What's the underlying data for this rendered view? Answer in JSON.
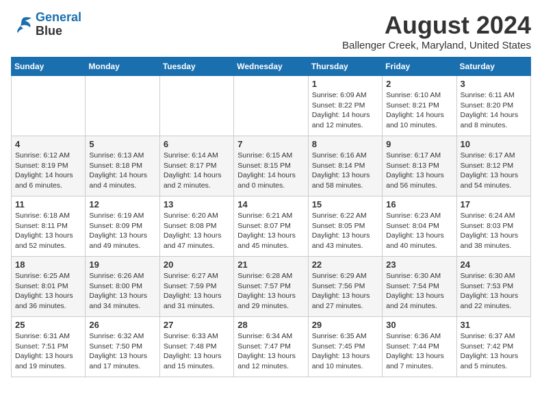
{
  "logo": {
    "line1": "General",
    "line2": "Blue"
  },
  "title": "August 2024",
  "location": "Ballenger Creek, Maryland, United States",
  "days_of_week": [
    "Sunday",
    "Monday",
    "Tuesday",
    "Wednesday",
    "Thursday",
    "Friday",
    "Saturday"
  ],
  "weeks": [
    [
      {
        "day": "",
        "info": ""
      },
      {
        "day": "",
        "info": ""
      },
      {
        "day": "",
        "info": ""
      },
      {
        "day": "",
        "info": ""
      },
      {
        "day": "1",
        "info": "Sunrise: 6:09 AM\nSunset: 8:22 PM\nDaylight: 14 hours\nand 12 minutes."
      },
      {
        "day": "2",
        "info": "Sunrise: 6:10 AM\nSunset: 8:21 PM\nDaylight: 14 hours\nand 10 minutes."
      },
      {
        "day": "3",
        "info": "Sunrise: 6:11 AM\nSunset: 8:20 PM\nDaylight: 14 hours\nand 8 minutes."
      }
    ],
    [
      {
        "day": "4",
        "info": "Sunrise: 6:12 AM\nSunset: 8:19 PM\nDaylight: 14 hours\nand 6 minutes."
      },
      {
        "day": "5",
        "info": "Sunrise: 6:13 AM\nSunset: 8:18 PM\nDaylight: 14 hours\nand 4 minutes."
      },
      {
        "day": "6",
        "info": "Sunrise: 6:14 AM\nSunset: 8:17 PM\nDaylight: 14 hours\nand 2 minutes."
      },
      {
        "day": "7",
        "info": "Sunrise: 6:15 AM\nSunset: 8:15 PM\nDaylight: 14 hours\nand 0 minutes."
      },
      {
        "day": "8",
        "info": "Sunrise: 6:16 AM\nSunset: 8:14 PM\nDaylight: 13 hours\nand 58 minutes."
      },
      {
        "day": "9",
        "info": "Sunrise: 6:17 AM\nSunset: 8:13 PM\nDaylight: 13 hours\nand 56 minutes."
      },
      {
        "day": "10",
        "info": "Sunrise: 6:17 AM\nSunset: 8:12 PM\nDaylight: 13 hours\nand 54 minutes."
      }
    ],
    [
      {
        "day": "11",
        "info": "Sunrise: 6:18 AM\nSunset: 8:11 PM\nDaylight: 13 hours\nand 52 minutes."
      },
      {
        "day": "12",
        "info": "Sunrise: 6:19 AM\nSunset: 8:09 PM\nDaylight: 13 hours\nand 49 minutes."
      },
      {
        "day": "13",
        "info": "Sunrise: 6:20 AM\nSunset: 8:08 PM\nDaylight: 13 hours\nand 47 minutes."
      },
      {
        "day": "14",
        "info": "Sunrise: 6:21 AM\nSunset: 8:07 PM\nDaylight: 13 hours\nand 45 minutes."
      },
      {
        "day": "15",
        "info": "Sunrise: 6:22 AM\nSunset: 8:05 PM\nDaylight: 13 hours\nand 43 minutes."
      },
      {
        "day": "16",
        "info": "Sunrise: 6:23 AM\nSunset: 8:04 PM\nDaylight: 13 hours\nand 40 minutes."
      },
      {
        "day": "17",
        "info": "Sunrise: 6:24 AM\nSunset: 8:03 PM\nDaylight: 13 hours\nand 38 minutes."
      }
    ],
    [
      {
        "day": "18",
        "info": "Sunrise: 6:25 AM\nSunset: 8:01 PM\nDaylight: 13 hours\nand 36 minutes."
      },
      {
        "day": "19",
        "info": "Sunrise: 6:26 AM\nSunset: 8:00 PM\nDaylight: 13 hours\nand 34 minutes."
      },
      {
        "day": "20",
        "info": "Sunrise: 6:27 AM\nSunset: 7:59 PM\nDaylight: 13 hours\nand 31 minutes."
      },
      {
        "day": "21",
        "info": "Sunrise: 6:28 AM\nSunset: 7:57 PM\nDaylight: 13 hours\nand 29 minutes."
      },
      {
        "day": "22",
        "info": "Sunrise: 6:29 AM\nSunset: 7:56 PM\nDaylight: 13 hours\nand 27 minutes."
      },
      {
        "day": "23",
        "info": "Sunrise: 6:30 AM\nSunset: 7:54 PM\nDaylight: 13 hours\nand 24 minutes."
      },
      {
        "day": "24",
        "info": "Sunrise: 6:30 AM\nSunset: 7:53 PM\nDaylight: 13 hours\nand 22 minutes."
      }
    ],
    [
      {
        "day": "25",
        "info": "Sunrise: 6:31 AM\nSunset: 7:51 PM\nDaylight: 13 hours\nand 19 minutes."
      },
      {
        "day": "26",
        "info": "Sunrise: 6:32 AM\nSunset: 7:50 PM\nDaylight: 13 hours\nand 17 minutes."
      },
      {
        "day": "27",
        "info": "Sunrise: 6:33 AM\nSunset: 7:48 PM\nDaylight: 13 hours\nand 15 minutes."
      },
      {
        "day": "28",
        "info": "Sunrise: 6:34 AM\nSunset: 7:47 PM\nDaylight: 13 hours\nand 12 minutes."
      },
      {
        "day": "29",
        "info": "Sunrise: 6:35 AM\nSunset: 7:45 PM\nDaylight: 13 hours\nand 10 minutes."
      },
      {
        "day": "30",
        "info": "Sunrise: 6:36 AM\nSunset: 7:44 PM\nDaylight: 13 hours\nand 7 minutes."
      },
      {
        "day": "31",
        "info": "Sunrise: 6:37 AM\nSunset: 7:42 PM\nDaylight: 13 hours\nand 5 minutes."
      }
    ]
  ]
}
